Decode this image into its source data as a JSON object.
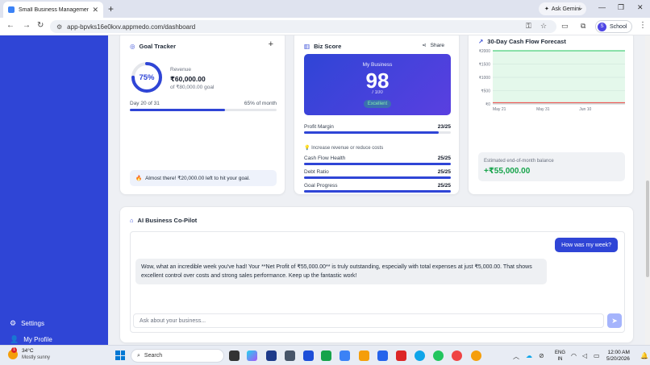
{
  "browser": {
    "tab_title": "Small Business Management Sa",
    "gemini_label": "Ask Gemini",
    "url": "app-bpvks16e0kxv.appmedo.com/dashboard",
    "profile_label": "School",
    "profile_initial": "S"
  },
  "sidebar": {
    "items": [
      {
        "label": "Settings",
        "icon": "gear-icon"
      },
      {
        "label": "My Profile",
        "icon": "user-icon"
      }
    ]
  },
  "goal_tracker": {
    "title": "Goal Tracker",
    "percent_label": "75%",
    "percent": 75,
    "revenue_label": "Revenue",
    "revenue_value": "₹60,000.00",
    "goal_text": "of ₹80,000.00 goal",
    "day_text": "Day 20 of 31",
    "month_pct_text": "65% of month",
    "month_progress": 0.65,
    "note": "Almost there! ₹20,000.00 left to hit your goal."
  },
  "biz_score": {
    "title": "Biz Score",
    "share_label": "Share",
    "business_label": "My Business",
    "score": "98",
    "out_of": "/ 100",
    "badge": "Excellent",
    "tip": "Increase revenue or reduce costs",
    "metrics": [
      {
        "name": "Profit Margin",
        "value": "23/25",
        "fraction": 0.92
      },
      {
        "name": "Cash Flow Health",
        "value": "25/25",
        "fraction": 1.0
      },
      {
        "name": "Debt Ratio",
        "value": "25/25",
        "fraction": 1.0
      },
      {
        "name": "Goal Progress",
        "value": "25/25",
        "fraction": 1.0
      }
    ]
  },
  "cash_flow": {
    "title": "30-Day Cash Flow Forecast",
    "balance_label": "Estimated end-of-month balance",
    "balance_value": "+₹55,000.00",
    "chart_data": {
      "type": "area",
      "title": "30-Day Cash Flow Forecast",
      "x_ticks": [
        "May 21",
        "May 31",
        "Jun 10"
      ],
      "y_ticks": [
        "₹2000",
        "₹1500",
        "₹1000",
        "₹500",
        "₹0"
      ],
      "ylim": [
        0,
        2000
      ],
      "series": [
        {
          "values": [
            2000,
            2000,
            2000,
            2000
          ],
          "color": "#22c55e"
        },
        {
          "values": [
            50,
            50,
            50,
            50
          ],
          "color": "#ef4444"
        }
      ],
      "grid": true
    }
  },
  "copilot": {
    "title": "AI Business Co-Pilot",
    "user_message": "How was my week?",
    "ai_message": "Wow, what an incredible week you've had! Your **Net Profit of ₹55,000.00** is truly outstanding, especially with total expenses at just ₹5,000.00. That shows excellent control over costs and strong sales performance. Keep up the fantastic work!",
    "input_placeholder": "Ask about your business..."
  },
  "taskbar": {
    "temperature": "34°C",
    "condition": "Mostly sunny",
    "weather_badge": "1",
    "search_label": "Search",
    "lang_line1": "ENG",
    "lang_line2": "IN",
    "time": "12:00 AM",
    "date": "5/20/2026"
  },
  "colors": {
    "brand": "#2f45d6",
    "positive": "#16a34a",
    "negative": "#ef4444"
  }
}
